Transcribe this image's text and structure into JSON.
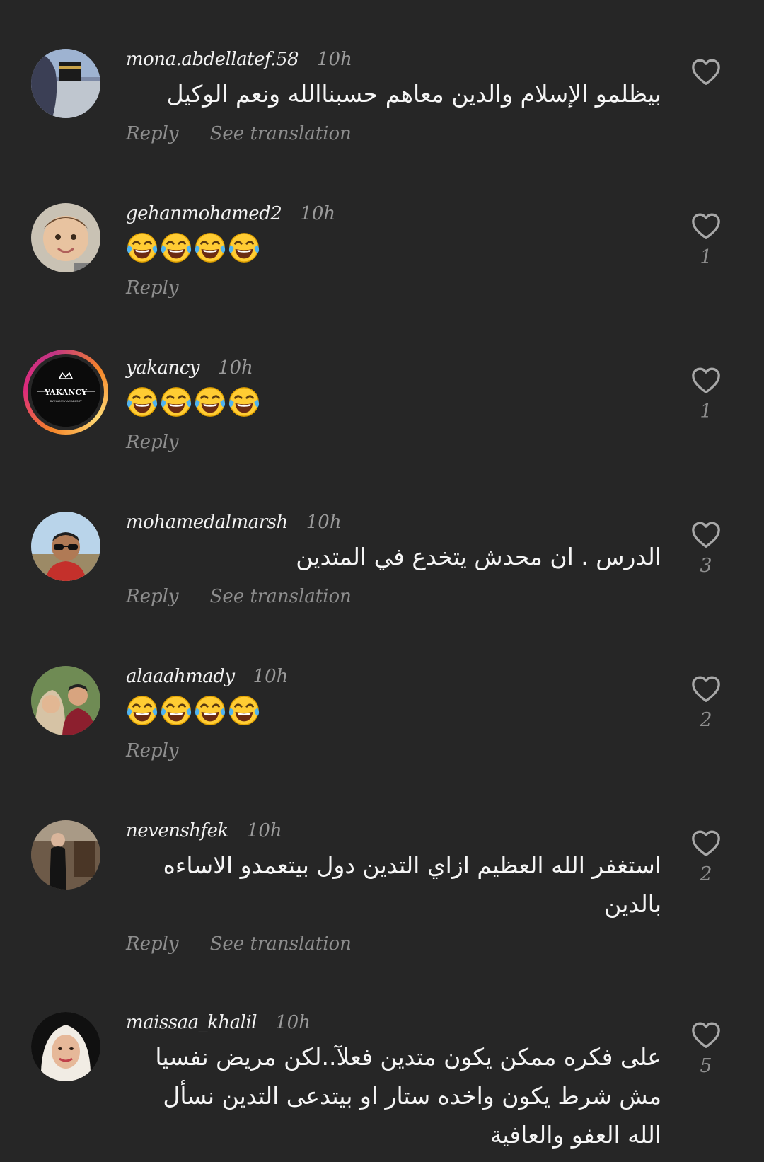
{
  "actions": {
    "reply": "Reply",
    "see_translation": "See translation"
  },
  "comments": [
    {
      "username": "mona.abdellatef.58",
      "time": "10h",
      "text": "بيظلمو الإسلام والدين معاهم حسبناالله ونعم الوكيل",
      "likes": "",
      "translatable": true
    },
    {
      "username": "gehanmohamed2",
      "time": "10h",
      "text": "😂😂😂😂",
      "likes": "1",
      "translatable": false
    },
    {
      "username": "yakancy",
      "time": "10h",
      "text": "😂😂😂😂",
      "likes": "1",
      "translatable": false,
      "avatar_logo_text": "YAKANCY",
      "avatar_logo_sub": "BY NANCY ACADEMY"
    },
    {
      "username": "mohamedalmarsh",
      "time": "10h",
      "text": "الدرس . ان محدش يتخدع في المتدين",
      "likes": "3",
      "translatable": true
    },
    {
      "username": "alaaahmady",
      "time": "10h",
      "text": "😂😂😂😂",
      "likes": "2",
      "translatable": false
    },
    {
      "username": "nevenshfek",
      "time": "10h",
      "text": "استغفر الله العظيم ازاي التدين دول بيتعمدو الاساءه بالدين",
      "likes": "2",
      "translatable": true
    },
    {
      "username": "maissaa_khalil",
      "time": "10h",
      "text": "على فكره ممكن يكون متدين فعلآ..لكن مريض نفسيا مش شرط يكون واخده ستار او بيتدعى التدين نسأل الله العفو والعافية",
      "likes": "5",
      "translatable": false
    }
  ],
  "icons": {
    "like": "heart-outline-icon",
    "emoji": "face-with-tears-of-joy"
  },
  "colors": {
    "background": "#262626",
    "primary_text": "#f5f5f5",
    "secondary_text": "#8e8e8e",
    "story_ring_start": "#f58529",
    "story_ring_end": "#c13584"
  }
}
